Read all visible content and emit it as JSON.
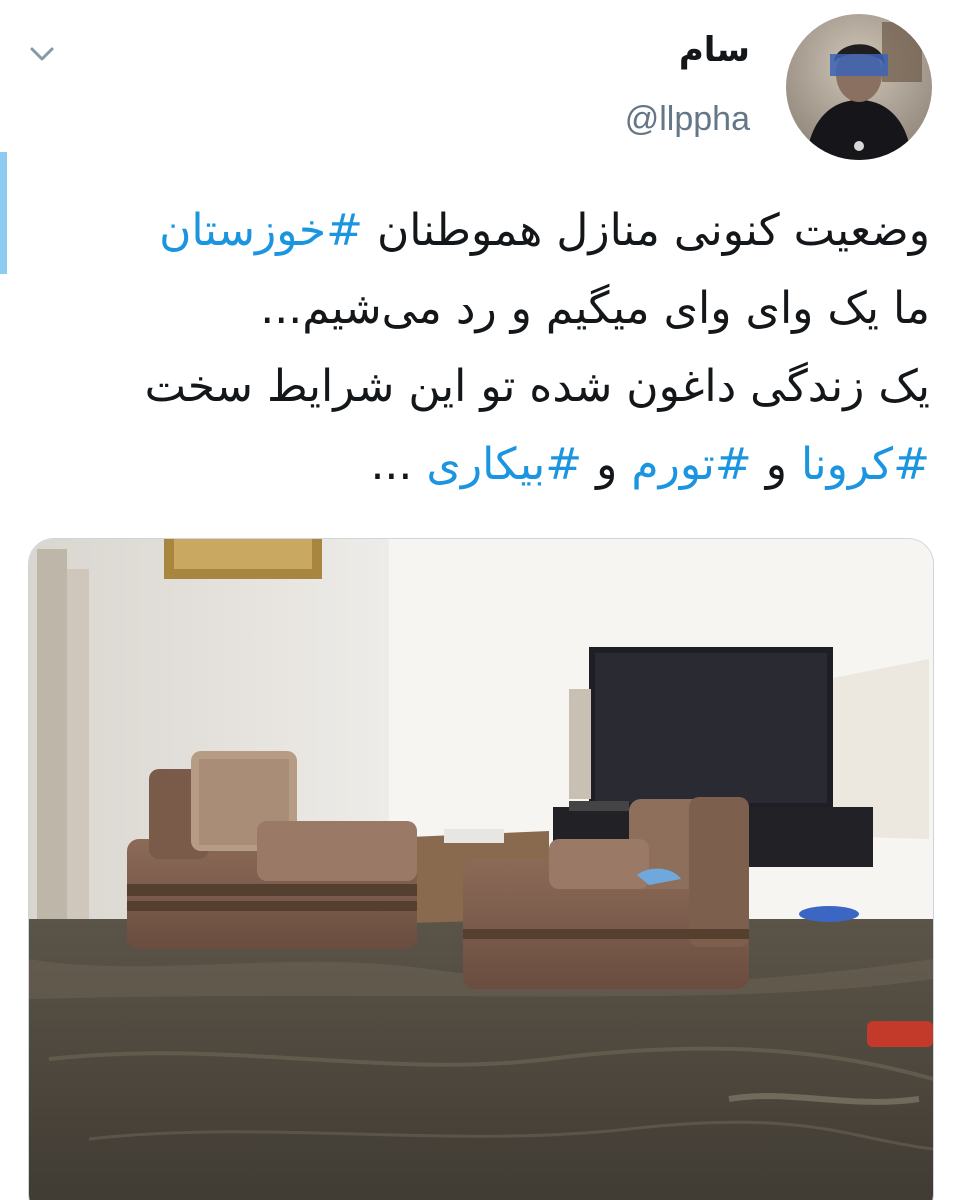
{
  "tweet": {
    "author": {
      "display_name": "سام",
      "handle": "@llppha"
    },
    "lines": [
      [
        {
          "text": "وضعیت کنونی منازل هموطنان ",
          "hashtag": false
        },
        {
          "text": "#خوزستان",
          "hashtag": true
        }
      ],
      [
        {
          "text": "ما یک وای وای میگیم و رد می‌شیم...",
          "hashtag": false
        }
      ],
      [
        {
          "text": "یک زندگی داغون شده تو این شرایط سخت",
          "hashtag": false
        }
      ],
      [
        {
          "text": "#کرونا",
          "hashtag": true
        },
        {
          "text": " و ",
          "hashtag": false
        },
        {
          "text": "#تورم",
          "hashtag": true
        },
        {
          "text": " و ",
          "hashtag": false
        },
        {
          "text": "#بیکاری",
          "hashtag": true
        },
        {
          "text": " ...",
          "hashtag": false
        }
      ]
    ]
  },
  "icons": {
    "menu": "chevron-down-icon"
  },
  "colors": {
    "hashtag": "#1b95e0",
    "handle": "#657786",
    "thread_bar": "#8ecbf1",
    "text": "#14171a"
  }
}
